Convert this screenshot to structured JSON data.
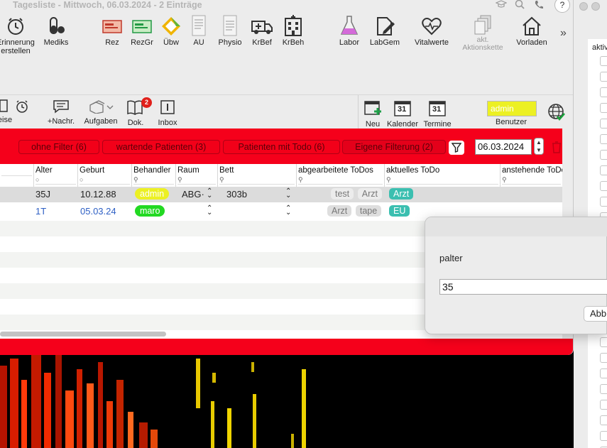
{
  "window": {
    "title": "Tagesliste - Mittwoch, 06.03.2024 - 2 Einträge",
    "help": "?"
  },
  "toolbar": {
    "items": [
      {
        "label": "Erinnerung",
        "label2": "erstellen",
        "icon": "alarm-clock-icon"
      },
      {
        "label": "Mediks",
        "icon": "pills-icon"
      },
      {
        "label": "Rez",
        "icon": "prescription-icon"
      },
      {
        "label": "RezGr",
        "icon": "prescription-green-icon"
      },
      {
        "label": "Übw",
        "icon": "referral-icon"
      },
      {
        "label": "AU",
        "icon": "au-form-icon"
      },
      {
        "label": "Physio",
        "icon": "physio-form-icon"
      },
      {
        "label": "KrBef",
        "icon": "ambulance-icon"
      },
      {
        "label": "KrBeh",
        "icon": "hospital-icon"
      },
      {
        "label": "Labor",
        "icon": "flask-icon"
      },
      {
        "label": "LabGem",
        "icon": "lab-edit-icon"
      },
      {
        "label": "Vitalwerte",
        "icon": "heartbeat-icon"
      },
      {
        "label": "akt.",
        "label2": "Aktionskette",
        "icon": "action-chain-icon"
      },
      {
        "label": "Vorladen",
        "icon": "house-icon"
      }
    ],
    "more": "»"
  },
  "toolbar2": {
    "reise": "eise",
    "nachr": "+Nachr.",
    "aufgaben": "Aufgaben",
    "dok": "Dok.",
    "dok_badge": "2",
    "inbox": "Inbox",
    "neu": "Neu",
    "kalender": "Kalender",
    "kalender_day": "31",
    "termine": "Termine",
    "termine_day": "31",
    "user": "admin",
    "user_label": "Benutzer"
  },
  "filters": {
    "buttons": [
      "ohne Filter (6)",
      "wartende Patienten (3)",
      "Patienten mit Todo (6)",
      "Eigene Filterung (2)"
    ],
    "date": "06.03.2024"
  },
  "table": {
    "columns": [
      "Alter",
      "Geburt",
      "Behandler",
      "Raum",
      "Bett",
      "abgearbeitete ToDos",
      "aktuelles ToDo",
      "anstehende ToDo"
    ],
    "rows": [
      {
        "alter": "35J",
        "geburt": "10.12.88",
        "behandler": "admin",
        "behandler_color": "#ecf023",
        "raum": "ABG·",
        "bett": "303b",
        "done": [
          "test",
          "Arzt"
        ],
        "current": "Arzt",
        "current_color": "#3bbfb0"
      },
      {
        "alter": "1T",
        "geburt": "05.03.24",
        "behandler": "maro",
        "behandler_color": "#22d922",
        "raum": "",
        "bett": "",
        "done": [
          "Arzt",
          "tape"
        ],
        "current": "EU",
        "current_color": "#3bbfb0"
      }
    ]
  },
  "dialog": {
    "label": "palter",
    "value": "35",
    "cancel": "Abbrechen"
  },
  "right_panel": {
    "header": "aktiv"
  }
}
